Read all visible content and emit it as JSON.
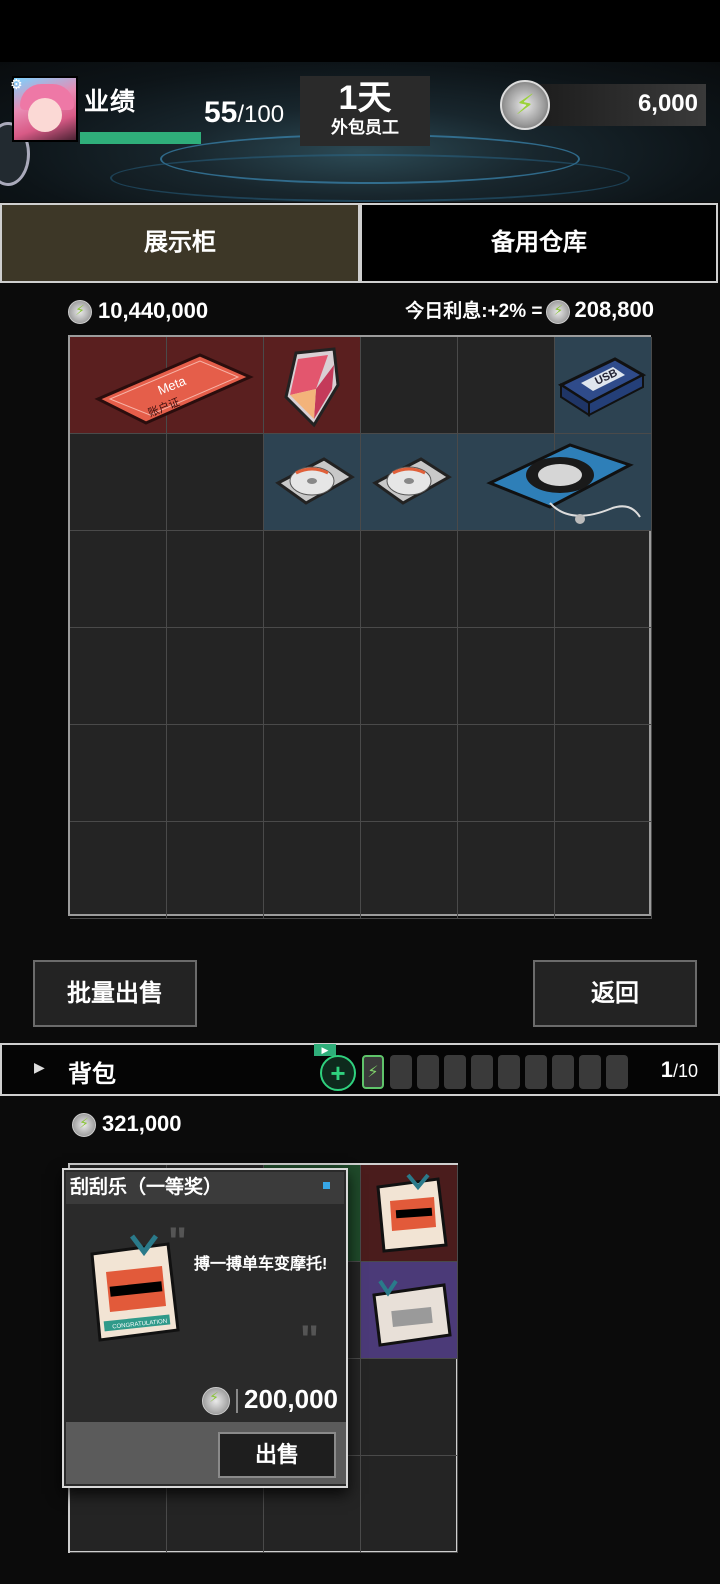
{
  "hud": {
    "performance_label": "业绩",
    "performance_current": "55",
    "performance_max": "/100",
    "performance_progress": 0.55,
    "day_value": "1天",
    "job_title": "外包员工",
    "energy_value": "6,000"
  },
  "tabs": [
    {
      "label": "展示柜",
      "active": true
    },
    {
      "label": "备用仓库",
      "active": false
    }
  ],
  "showcase": {
    "money": "10,440,000",
    "interest_label": "今日利息:+2% =",
    "interest_value": "208,800",
    "items": [
      {
        "name": "meta-account-card",
        "text": "Meta",
        "subtext": "账户证"
      },
      {
        "name": "crystal-shard"
      },
      {
        "name": "usb-drive",
        "text": "USB"
      },
      {
        "name": "cd-disc"
      },
      {
        "name": "cd-disc"
      },
      {
        "name": "cd-player"
      }
    ]
  },
  "buttons": {
    "bulk_sell": "批量出售",
    "back": "返回"
  },
  "backpack": {
    "title": "背包",
    "ad_tag": "▶",
    "add_icon": "+",
    "count_current": "1",
    "count_max": "/10",
    "money": "321,000",
    "filled_batteries": 1,
    "total_batteries": 10
  },
  "item_popup": {
    "title": "刮刮乐（一等奖）",
    "description": "搏一搏单车变摩托!",
    "price": "200,000",
    "sell_label": "出售",
    "card_stamp": "CONGRATULATION"
  },
  "colors": {
    "accent_green": "#2fae7a",
    "tab_active": "#3d3727",
    "cell_red": "#5a1f1f",
    "cell_blue": "#2d4352",
    "cell_purple": "#4b3a78"
  }
}
